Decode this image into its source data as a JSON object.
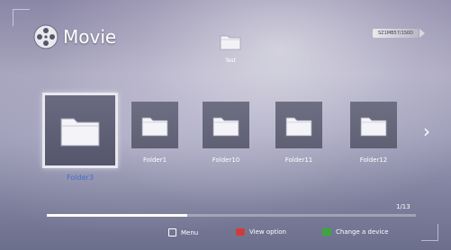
{
  "header": {
    "title": "Movie",
    "logo_icon": "film-reel-icon"
  },
  "device": {
    "label": "SZ1MB57/1S0D"
  },
  "parent": {
    "label": "Test",
    "icon": "folder-icon"
  },
  "folders": [
    {
      "label": "Folder3",
      "icon": "folder-icon",
      "selected": true
    },
    {
      "label": "Folder1",
      "icon": "folder-icon",
      "selected": false
    },
    {
      "label": "Folder10",
      "icon": "folder-icon",
      "selected": false
    },
    {
      "label": "Folder11",
      "icon": "folder-icon",
      "selected": false
    },
    {
      "label": "Folder12",
      "icon": "folder-icon",
      "selected": false
    }
  ],
  "next_arrow": "›",
  "progress": {
    "fraction": 0.38,
    "page": "1/13"
  },
  "footer": {
    "menu_label": "Menu",
    "view_option_label": "View option",
    "change_device_label": "Change a device",
    "red_key_color": "#d23b3b",
    "green_key_color": "#3aa83a"
  },
  "colors": {
    "selected_label": "#3f6fcf"
  }
}
